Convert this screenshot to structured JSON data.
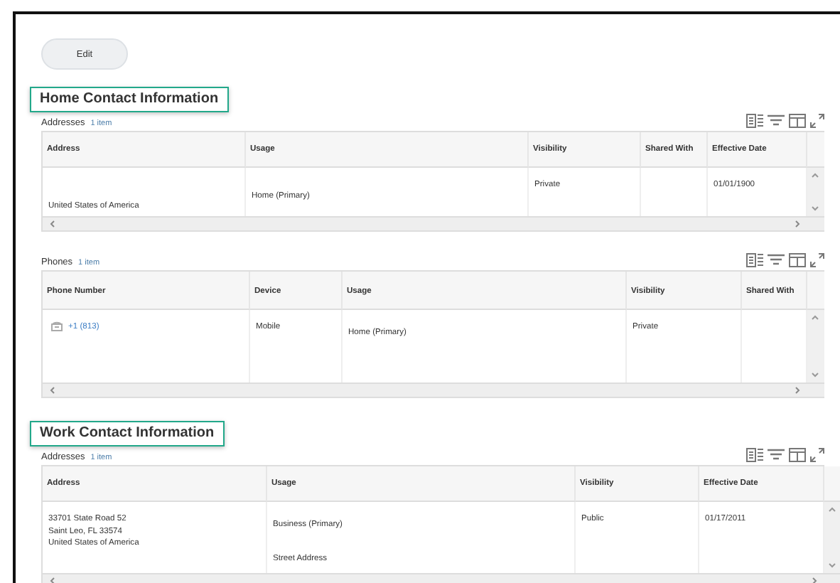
{
  "edit_button": "Edit",
  "sections": [
    {
      "title": "Home Contact Information",
      "highlighted": true,
      "tables": [
        {
          "name": "Addresses",
          "count": "1 item",
          "columns": [
            "Address",
            "Usage",
            "Visibility",
            "Shared With",
            "Effective Date"
          ],
          "rows": [
            [
              {
                "lines": [
                  "United States of America"
                ]
              },
              {
                "lines": [
                  "Home (Primary)"
                ]
              },
              {
                "lines": [
                  "Private"
                ]
              },
              {},
              {
                "lines": [
                  "01/01/1900"
                ]
              }
            ]
          ]
        },
        {
          "name": "Phones",
          "count": "1 item",
          "columns": [
            "Phone Number",
            "Device",
            "Usage",
            "Visibility",
            "Shared With"
          ],
          "rows": [
            [
              {
                "lines": [
                  "+1 (813)"
                ],
                "kind": "phone"
              },
              {
                "lines": [
                  "Mobile"
                ]
              },
              {
                "lines": [
                  "Home (Primary)"
                ]
              },
              {
                "lines": [
                  "Private"
                ]
              },
              {}
            ]
          ]
        }
      ]
    },
    {
      "title": "Work Contact Information",
      "highlighted": true,
      "tables": [
        {
          "name": "Addresses",
          "count": "1 item",
          "columns": [
            "Address",
            "Usage",
            "Visibility",
            "Effective Date"
          ],
          "rows": [
            [
              {
                "lines": [
                  "33701 State Road 52\nSaint Leo, FL 33574\nUnited States of America"
                ]
              },
              {
                "lines": [
                  "Business (Primary)",
                  "Street Address"
                ]
              },
              {
                "lines": [
                  "Public"
                ]
              },
              {
                "lines": [
                  "01/17/2011"
                ]
              }
            ]
          ]
        }
      ]
    }
  ]
}
